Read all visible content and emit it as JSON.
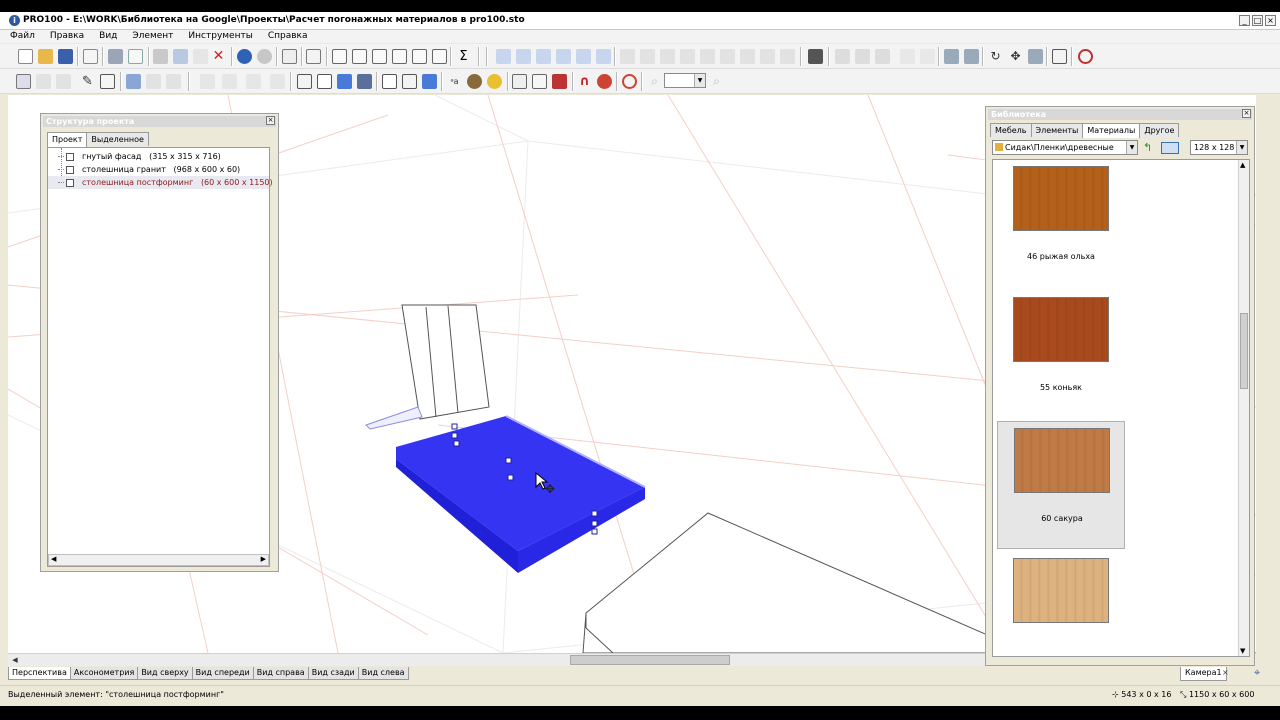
{
  "window": {
    "title": "PRO100 - E:\\WORK\\Библиотека на Google\\Проекты\\Расчет погонажных материалов в pro100.sto",
    "app_icon": "pro100-app-icon",
    "controls": [
      "_",
      "□",
      "×"
    ]
  },
  "menu": [
    "Файл",
    "Правка",
    "Вид",
    "Элемент",
    "Инструменты",
    "Справка"
  ],
  "toolbar": {
    "sum_label": "Σ",
    "zoom_value": ""
  },
  "structure_panel": {
    "title": "Структура проекта",
    "close": "×",
    "tabs": [
      {
        "label": "Проект",
        "active": true
      },
      {
        "label": "Выделенное",
        "active": false
      }
    ],
    "items": [
      {
        "name": "гнутый фасад",
        "size": "(315 x 315 x 716)",
        "selected": false
      },
      {
        "name": "столешница гранит",
        "size": "(968 x 600 x 60)",
        "selected": false
      },
      {
        "name": "столешница постформинг",
        "size": "(60 x 600 x 1150)",
        "selected": true
      }
    ]
  },
  "library_panel": {
    "title": "Библиотека",
    "close": "×",
    "tabs": [
      {
        "label": "Мебель",
        "active": false
      },
      {
        "label": "Элементы",
        "active": false
      },
      {
        "label": "Материалы",
        "active": true
      },
      {
        "label": "Другое",
        "active": false
      }
    ],
    "path": "Сидак\\Пленки\\древесные",
    "thumb_size": "128 x 128",
    "materials": [
      {
        "label": "46 рыжая ольха",
        "color": "#b4601a",
        "selected": false
      },
      {
        "label": "55 коньяк",
        "color": "#a84a1e",
        "selected": false
      },
      {
        "label": "60 сакура",
        "color": "#c07a45",
        "selected": true
      },
      {
        "label": "",
        "color": "#ddb27e",
        "selected": false
      }
    ]
  },
  "view_tabs": [
    {
      "label": "Перспектива",
      "active": true
    },
    {
      "label": "Аксонометрия",
      "active": false
    },
    {
      "label": "Вид сверху",
      "active": false
    },
    {
      "label": "Вид спереди",
      "active": false
    },
    {
      "label": "Вид справа",
      "active": false
    },
    {
      "label": "Вид сзади",
      "active": false
    },
    {
      "label": "Вид слева",
      "active": false
    }
  ],
  "camera_tab": "Камера1",
  "camera_close": "×",
  "status": {
    "message": "Выделенный элемент: \"столешница постформинг\"",
    "position": "543 x 0 x 16",
    "dimensions": "1150 x 60 x 600"
  },
  "scene": {
    "selection_color": "#2626ff",
    "grid_color": "#f2c8c0",
    "room_line_color": "#e8e8e8"
  }
}
